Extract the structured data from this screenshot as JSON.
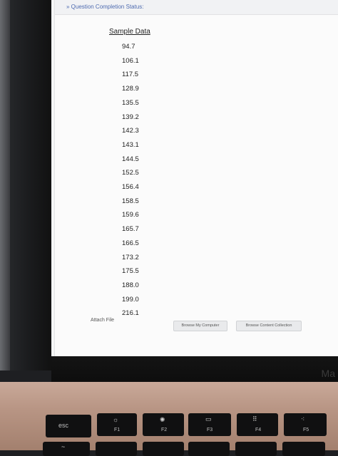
{
  "status": {
    "label": "» Question Completion Status:"
  },
  "table": {
    "header": "Sample Data",
    "values": [
      "94.7",
      "106.1",
      "117.5",
      "128.9",
      "135.5",
      "139.2",
      "142.3",
      "143.1",
      "144.5",
      "152.5",
      "156.4",
      "158.5",
      "159.6",
      "165.7",
      "166.5",
      "173.2",
      "175.5",
      "188.0",
      "199.0",
      "216.1"
    ]
  },
  "attach": {
    "label": "Attach File",
    "browse_computer": "Browse My Computer",
    "browse_content": "Browse Content Collection"
  },
  "laptop": {
    "brand_partial": "Ma"
  },
  "keyboard": {
    "esc": "esc",
    "f1": "F1",
    "f2": "F2",
    "f3": "F3",
    "f4": "F4",
    "f5": "F5",
    "tilde": "~"
  },
  "colors": {
    "link_blue": "#4e6bb0",
    "page_bg": "#fbfbfb",
    "deck": "#b89584"
  }
}
